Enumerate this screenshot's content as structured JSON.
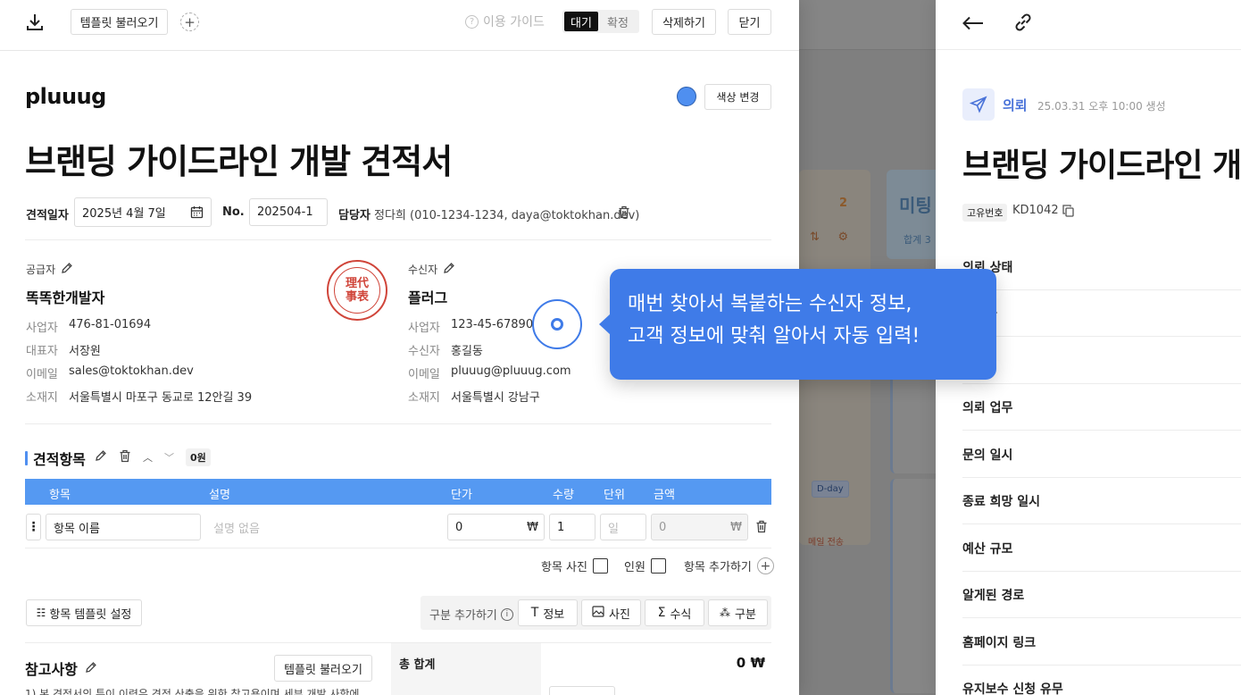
{
  "toolbar": {
    "download_icon": "download-icon",
    "template_load": "템플릿 불러오기",
    "add_icon": "plus-icon",
    "guide": "이용 가이드",
    "status_toggle": [
      "대기",
      "확정"
    ],
    "status_active": "대기",
    "delete": "삭제하기",
    "close": "닫기"
  },
  "brand": {
    "logo": "pluuug",
    "color_change": "색상 변경",
    "accent_color": "#4f8ff0"
  },
  "doc": {
    "title": "브랜딩 가이드라인 개발 견적서",
    "date_label": "견적일자",
    "date_value": "2025년 4월 7일",
    "no_label": "No.",
    "no_value": "202504-1",
    "manager_label": "담당자",
    "manager_value": "정다희 (010-1234-1234, daya@toktokhan.dev)"
  },
  "supplier": {
    "label": "공급자",
    "name": "똑똑한개발자",
    "rows": [
      {
        "k": "사업자",
        "v": "476-81-01694"
      },
      {
        "k": "대표자",
        "v": "서장원"
      },
      {
        "k": "이메일",
        "v": "sales@toktokhan.dev"
      },
      {
        "k": "소재지",
        "v": "서울특별시 마포구 동교로 12안길 39"
      }
    ],
    "stamp": [
      "理代",
      "事表"
    ]
  },
  "receiver": {
    "label": "수신자",
    "name": "플러그",
    "rows": [
      {
        "k": "사업자",
        "v": "123-45-67890"
      },
      {
        "k": "수신자",
        "v": "홍길동"
      },
      {
        "k": "이메일",
        "v": "pluuug@pluuug.com"
      },
      {
        "k": "소재지",
        "v": "서울특별시 강남구"
      }
    ]
  },
  "items": {
    "title": "견적항목",
    "total_badge": "0원",
    "headers": [
      "항목",
      "설명",
      "단가",
      "수량",
      "단위",
      "금액"
    ],
    "row": {
      "name": "항목 이름",
      "desc_placeholder": "설명 없음",
      "price": "0",
      "qty": "1",
      "unit_placeholder": "일",
      "amount": "0",
      "currency": "₩"
    },
    "opt_photo": "항목 사진",
    "opt_person": "인원",
    "opt_add": "항목 추가하기",
    "template_setting": "항목 템플릿 설정",
    "block_add": "구분 추가하기",
    "blocks": [
      "정보",
      "사진",
      "수식",
      "구분"
    ]
  },
  "notes": {
    "title": "참고사항",
    "template_load": "템플릿 불러오기",
    "text": "1) 본 견적서의 특이 이력은 견적 산출을 위한 참고용이며 세부 개발 사항에"
  },
  "summary": {
    "label": "총 합계",
    "value": "0 ₩"
  },
  "tooltip": {
    "line1": "매번 찾아서 복붙하는 수신자 정보,",
    "line2": "고객 정보에 맞춰 알아서 자동 입력!"
  },
  "background": {
    "num": "2",
    "title": "미팅",
    "sub": "합계  3",
    "badge": "D-day",
    "badge2": "메일 전송"
  },
  "drawer": {
    "req_label": "의뢰",
    "req_date": "25.03.31 오후 10:00 생성",
    "title": "브랜딩 가이드라인 개발 견적서",
    "uid_tag": "고유번호",
    "uid_value": "KD1042",
    "rows": [
      "의뢰 상태",
      "담당자",
      "견적",
      "의뢰 업무",
      "문의 일시",
      "종료 희망 일시",
      "예산 규모",
      "알게된 경로",
      "홈페이지 링크",
      "유지보수 신청 유무"
    ]
  }
}
